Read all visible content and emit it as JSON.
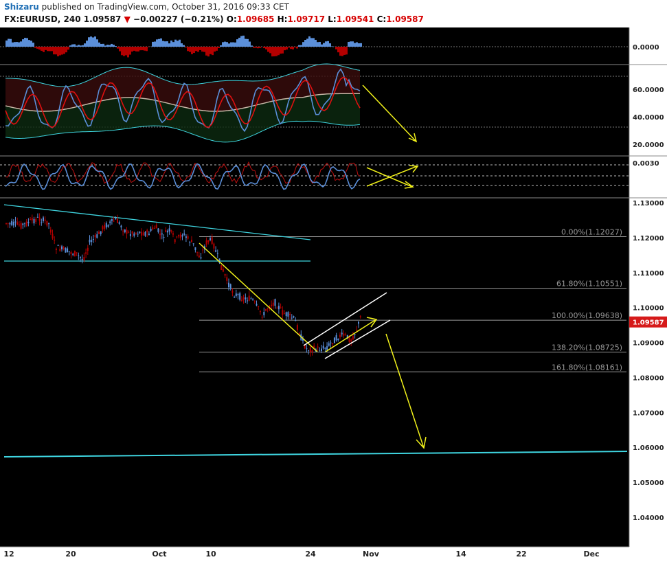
{
  "header": {
    "author": "Shizaru",
    "published": " published on TradingView.com, October 31, 2016 09:33 CET",
    "symbol": "FX:EURUSD, 240",
    "last": "1.09587",
    "change": "−0.00227 (−0.21%)",
    "o_label": "O:",
    "o_val": "1.09685",
    "h_label": "H:",
    "h_val": "1.09717",
    "l_label": "L:",
    "l_val": "1.09541",
    "c_label": "C:",
    "c_val": "1.09587",
    "down_arrow": "▼"
  },
  "colors": {
    "bg": "#000000",
    "up": "#5b8fd9",
    "down": "#b30000",
    "trend": "#3fd5e0",
    "annotation": "#f2f21a",
    "channel": "#ffffff",
    "fib": "#9a9a9a",
    "axis_bg": "#ffffff",
    "price_tag": "#d61a1a"
  },
  "chart_data": [
    {
      "type": "area",
      "panel": "histogram oscillator",
      "axis_ticks": [
        "0.0000"
      ]
    },
    {
      "type": "line",
      "panel": "oscillator with bands",
      "axis_ticks": [
        "60.0000",
        "40.0000",
        "20.0000"
      ]
    },
    {
      "type": "line",
      "panel": "oscillator",
      "axis_ticks": [
        "0.0030"
      ]
    },
    {
      "type": "line",
      "panel": "price (candlestick)",
      "axis_ticks": [
        "1.13000",
        "1.12000",
        "1.11000",
        "1.10000",
        "1.09000",
        "1.08000",
        "1.07000",
        "1.06000",
        "1.05000",
        "1.04000"
      ],
      "ylim": [
        1.0349,
        1.1322
      ],
      "last_price": "1.09587",
      "fib_levels": [
        {
          "label": "0.00%(1.12027)",
          "value": 1.12027
        },
        {
          "label": "61.80%(1.10551)",
          "value": 1.10551
        },
        {
          "label": "100.00%(1.09638)",
          "value": 1.09638
        },
        {
          "label": "138.20%(1.08725)",
          "value": 1.08725
        },
        {
          "label": "161.80%(1.08161)",
          "value": 1.08161
        }
      ],
      "x_labels": [
        "12",
        "20",
        "Oct",
        "10",
        "24",
        "Nov",
        "14",
        "22",
        "Dec"
      ]
    }
  ]
}
